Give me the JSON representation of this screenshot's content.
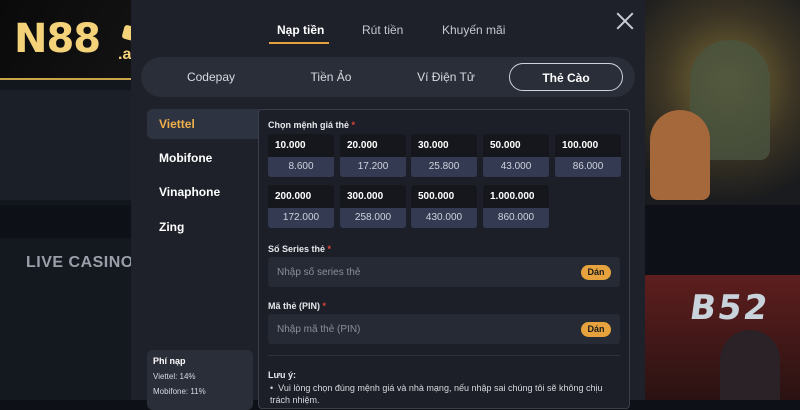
{
  "logo": {
    "brand": "N88",
    "suffix": ".art"
  },
  "background": {
    "live_casino_title": "LIVE CASINO",
    "game_badge": "B52"
  },
  "top_tabs": [
    {
      "label": "Nạp tiền",
      "active": true
    },
    {
      "label": "Rút tiền",
      "active": false
    },
    {
      "label": "Khuyến mãi",
      "active": false
    }
  ],
  "methods": [
    {
      "label": "Codepay",
      "active": false
    },
    {
      "label": "Tiền Ảo",
      "active": false
    },
    {
      "label": "Ví Điện Tử",
      "active": false
    },
    {
      "label": "Thẻ Cào",
      "active": true
    }
  ],
  "carriers": [
    {
      "label": "Viettel",
      "active": true
    },
    {
      "label": "Mobifone",
      "active": false
    },
    {
      "label": "Vinaphone",
      "active": false
    },
    {
      "label": "Zing",
      "active": false
    }
  ],
  "fees": {
    "title": "Phí nạp",
    "lines": [
      "Viettel: 14%",
      "Mobifone: 11%"
    ]
  },
  "denomination_label": "Chọn mệnh giá thẻ",
  "denominations": [
    {
      "face": "10.000",
      "credit": "8.600"
    },
    {
      "face": "20.000",
      "credit": "17.200"
    },
    {
      "face": "30.000",
      "credit": "25.800"
    },
    {
      "face": "50.000",
      "credit": "43.000"
    },
    {
      "face": "100.000",
      "credit": "86.000"
    },
    {
      "face": "200.000",
      "credit": "172.000"
    },
    {
      "face": "300.000",
      "credit": "258.000"
    },
    {
      "face": "500.000",
      "credit": "430.000"
    },
    {
      "face": "1.000.000",
      "credit": "860.000"
    }
  ],
  "serial": {
    "label": "Số Series thẻ",
    "placeholder": "Nhập số series thẻ",
    "paste": "Dán"
  },
  "pin": {
    "label": "Mã thẻ (PIN)",
    "placeholder": "Nhập mã thẻ (PIN)",
    "paste": "Dán"
  },
  "note": {
    "title": "Lưu ý:",
    "text": "Vui lòng chọn đúng mệnh giá và nhà mạng, nếu nhập sai chúng tôi sẽ không chịu trách nhiệm."
  },
  "required_mark": "*",
  "colors": {
    "accent": "#e6a33d",
    "active_carrier": "#f0b04a",
    "required": "#e0453a"
  },
  "icons": {
    "close": "close-icon"
  }
}
